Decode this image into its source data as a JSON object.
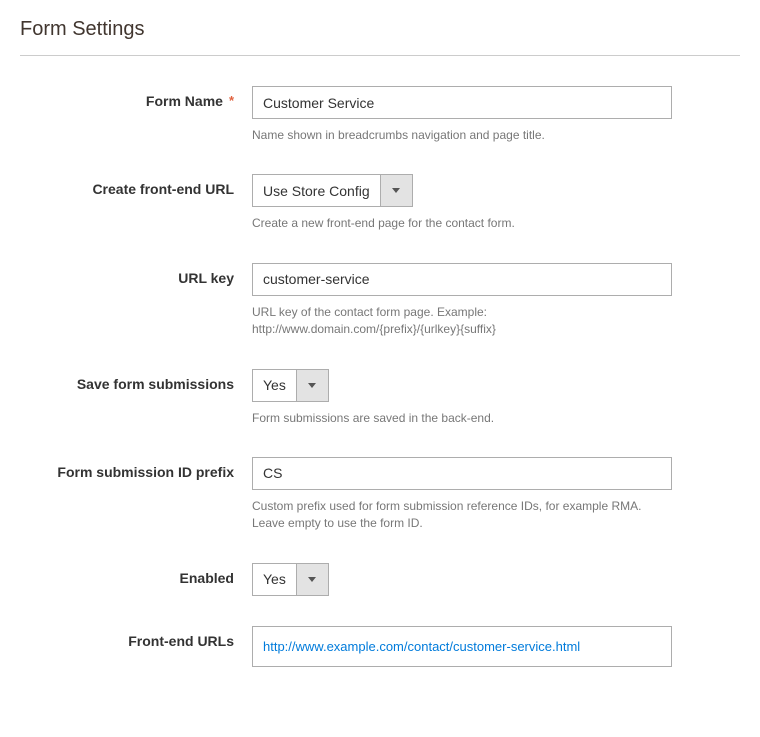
{
  "section_title": "Form Settings",
  "fields": {
    "form_name": {
      "label": "Form Name",
      "required": true,
      "value": "Customer Service",
      "hint": "Name shown in breadcrumbs navigation and page title."
    },
    "create_url": {
      "label": "Create front-end URL",
      "value": "Use Store Config",
      "hint": "Create a new front-end page for the contact form."
    },
    "url_key": {
      "label": "URL key",
      "value": "customer-service",
      "hint": "URL key of the contact form page. Example: http://www.domain.com/{prefix}/{urlkey}{suffix}"
    },
    "save_submissions": {
      "label": "Save form submissions",
      "value": "Yes",
      "hint": "Form submissions are saved in the back-end."
    },
    "id_prefix": {
      "label": "Form submission ID prefix",
      "value": "CS",
      "hint": "Custom prefix used for form submission reference IDs, for example RMA. Leave empty to use the form ID."
    },
    "enabled": {
      "label": "Enabled",
      "value": "Yes"
    },
    "frontend_urls": {
      "label": "Front-end URLs",
      "url": "http://www.example.com/contact/customer-service.html"
    }
  }
}
